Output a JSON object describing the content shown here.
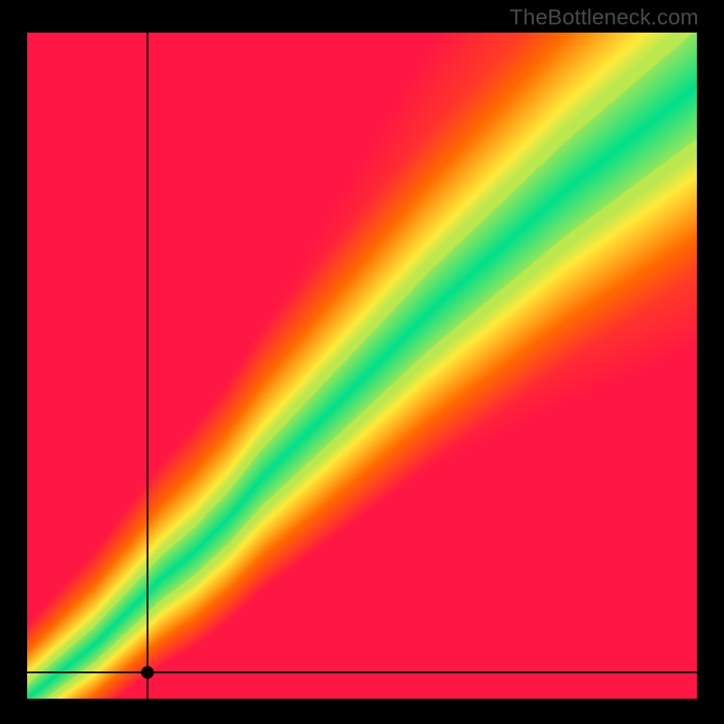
{
  "watermark": "TheBottleneck.com",
  "chart_data": {
    "type": "heatmap",
    "title": "",
    "xlabel": "",
    "ylabel": "",
    "xlim": [
      0,
      100
    ],
    "ylim": [
      0,
      100
    ],
    "crosshair": {
      "x": 18,
      "y": 4
    },
    "marker": {
      "x": 18,
      "y": 4
    },
    "optimal_curve_points": [
      {
        "x": 0,
        "y": 0
      },
      {
        "x": 5,
        "y": 4
      },
      {
        "x": 10,
        "y": 8
      },
      {
        "x": 15,
        "y": 13
      },
      {
        "x": 20,
        "y": 18
      },
      {
        "x": 25,
        "y": 22
      },
      {
        "x": 30,
        "y": 27
      },
      {
        "x": 35,
        "y": 33
      },
      {
        "x": 40,
        "y": 38
      },
      {
        "x": 50,
        "y": 48
      },
      {
        "x": 60,
        "y": 58
      },
      {
        "x": 70,
        "y": 67
      },
      {
        "x": 80,
        "y": 76
      },
      {
        "x": 90,
        "y": 84
      },
      {
        "x": 100,
        "y": 92
      }
    ],
    "band_spread": {
      "bottom_left": 3,
      "top_right": 12
    },
    "color_scale": [
      {
        "stop": 0.0,
        "color": "#ff1744",
        "meaning": "severe bottleneck"
      },
      {
        "stop": 0.35,
        "color": "#ff6a00",
        "meaning": "bottleneck"
      },
      {
        "stop": 0.6,
        "color": "#ffeb3b",
        "meaning": "mild"
      },
      {
        "stop": 0.85,
        "color": "#00e676",
        "meaning": "balanced"
      },
      {
        "stop": 1.0,
        "color": "#00e08a",
        "meaning": "optimal"
      }
    ],
    "description": "Heatmap showing closeness to an optimal pairing along a diagonal band. Colors shift red→orange→yellow→green as (x,y) approaches the optimal curve. A black crosshair and dot mark a specific selected point near the lower-left."
  }
}
